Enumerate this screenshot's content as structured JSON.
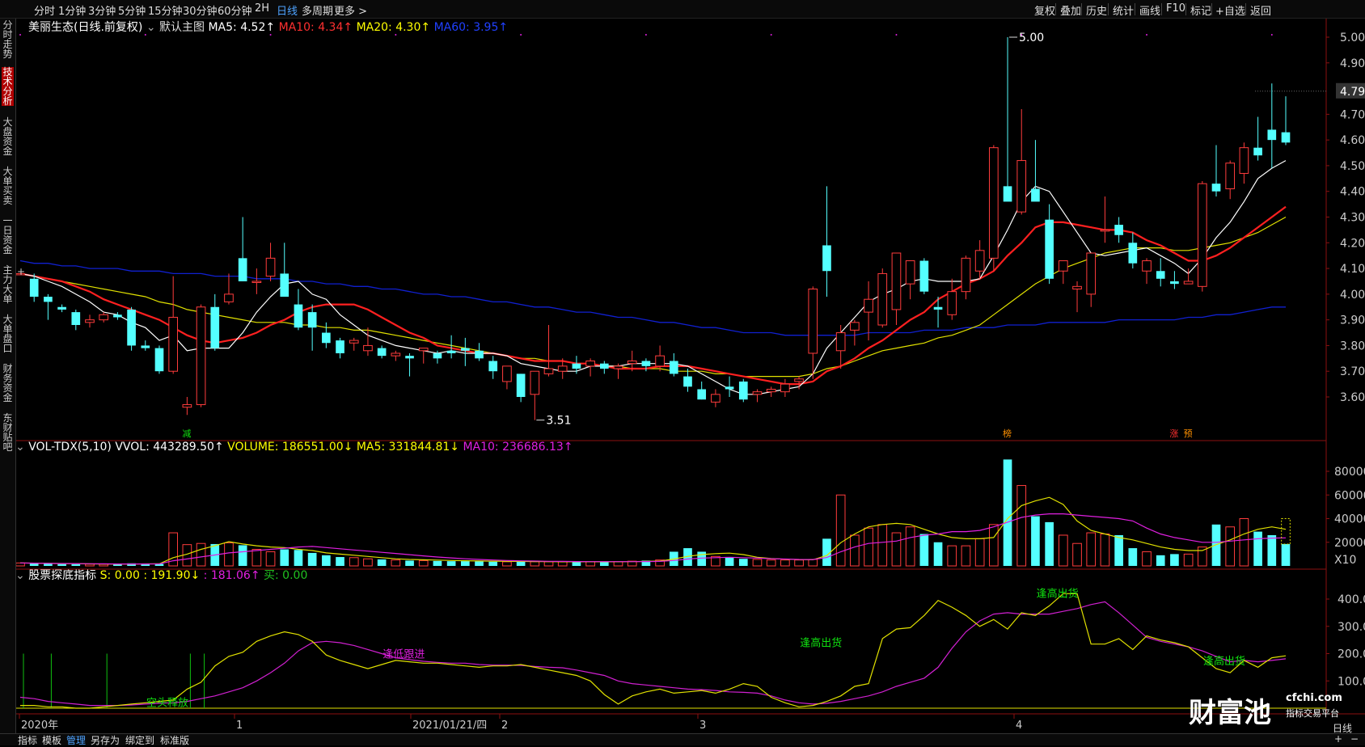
{
  "timeframes": [
    "分时",
    "1分钟",
    "3分钟",
    "5分钟",
    "15分钟",
    "30分钟",
    "60分钟",
    "2H",
    "日线",
    "多周期",
    "更多 >"
  ],
  "active_timeframe": "日线",
  "right_tools": [
    "复权",
    "叠加",
    "历史",
    "统计",
    "画线",
    "F10",
    "标记",
    "+自选",
    "返回"
  ],
  "left_tabs": [
    "分时走势",
    "技术分析",
    "大盘资金",
    "大单买卖",
    "一日资金",
    "主力大单",
    "大单盘口",
    "财务资金",
    "东财贴吧"
  ],
  "active_left_tab": "技术分析",
  "main_legend": {
    "title": "美丽生态(日线.前复权)",
    "template": "默认主图",
    "ma5": "MA5: 4.52↑",
    "ma10": "MA10: 4.34↑",
    "ma20": "MA20: 4.30↑",
    "ma60": "MA60: 3.95↑"
  },
  "vol_legend": {
    "name": "VOL-TDX(5,10)",
    "vvol": "VVOL: 443289.50↑",
    "volume": "VOLUME: 186551.00↓",
    "ma5": "MA5: 331844.81↓",
    "ma10": "MA10: 236686.13↑"
  },
  "ind_legend": {
    "name": "股票探底指标",
    "s": "S: 0.00",
    "v1": ": 191.90↓",
    "v2": ": 181.06↑",
    "buy": "买: 0.00"
  },
  "price_axis": [
    "5.00",
    "4.90",
    "4.70",
    "4.60",
    "4.50",
    "4.40",
    "4.30",
    "4.20",
    "4.10",
    "4.00",
    "3.90",
    "3.80",
    "3.70",
    "3.60"
  ],
  "current_price": "4.79",
  "vol_axis": [
    "80000",
    "60000",
    "40000",
    "20000"
  ],
  "vol_unit": "X10",
  "ind_axis": [
    "400.0",
    "300.0",
    "200.0",
    "100.0"
  ],
  "annotations": {
    "high": "5.00",
    "low": "3.51",
    "markers": [
      "减",
      "榜",
      "涨",
      "预"
    ],
    "signals": [
      "空头释放",
      "逢低跟进",
      "逢高出货",
      "逢高出货",
      "逢高出货"
    ]
  },
  "date_axis": [
    "2020年",
    "1",
    "2021/01/21/四",
    "2",
    "3",
    "4"
  ],
  "bottom_tabs": [
    "指标",
    "模板",
    "管理",
    "另存为",
    "绑定到",
    "标准版"
  ],
  "active_bottom_tab": "管理",
  "bottom_right": [
    "日线",
    "+",
    "−"
  ],
  "logo": {
    "brand": "财富池",
    "domain": "cfchi.com",
    "slogan": "指标交易平台"
  },
  "chart_data": {
    "type": "candlestick",
    "ylim": [
      3.45,
      5.05
    ],
    "candles": [
      [
        4.08,
        4.08,
        4.08,
        4.08
      ],
      [
        4.06,
        4.08,
        3.97,
        3.99
      ],
      [
        3.99,
        4.0,
        3.9,
        3.97
      ],
      [
        3.95,
        3.96,
        3.93,
        3.94
      ],
      [
        3.93,
        3.94,
        3.86,
        3.88
      ],
      [
        3.89,
        3.92,
        3.87,
        3.9
      ],
      [
        3.9,
        3.93,
        3.89,
        3.92
      ],
      [
        3.92,
        3.93,
        3.9,
        3.91
      ],
      [
        3.94,
        3.95,
        3.78,
        3.8
      ],
      [
        3.8,
        3.82,
        3.78,
        3.79
      ],
      [
        3.79,
        3.8,
        3.69,
        3.7
      ],
      [
        3.7,
        4.07,
        3.69,
        3.91
      ],
      [
        3.56,
        3.6,
        3.53,
        3.57
      ],
      [
        3.57,
        3.96,
        3.56,
        3.95
      ],
      [
        3.95,
        4.0,
        3.78,
        3.79
      ],
      [
        3.97,
        4.08,
        3.96,
        4.0
      ],
      [
        4.14,
        4.3,
        4.05,
        4.05
      ],
      [
        4.05,
        4.1,
        4.0,
        4.05
      ],
      [
        4.07,
        4.2,
        4.05,
        4.14
      ],
      [
        4.08,
        4.2,
        4.0,
        3.99
      ],
      [
        3.96,
        4.02,
        3.86,
        3.87
      ],
      [
        3.93,
        3.96,
        3.78,
        3.87
      ],
      [
        3.85,
        3.89,
        3.79,
        3.81
      ],
      [
        3.82,
        3.83,
        3.75,
        3.77
      ],
      [
        3.81,
        3.83,
        3.78,
        3.82
      ],
      [
        3.78,
        3.87,
        3.76,
        3.8
      ],
      [
        3.79,
        3.8,
        3.75,
        3.76
      ],
      [
        3.76,
        3.78,
        3.74,
        3.77
      ],
      [
        3.76,
        3.77,
        3.68,
        3.75
      ],
      [
        3.78,
        3.79,
        3.73,
        3.79
      ],
      [
        3.77,
        3.78,
        3.73,
        3.75
      ],
      [
        3.78,
        3.84,
        3.75,
        3.77
      ],
      [
        3.79,
        3.83,
        3.72,
        3.78
      ],
      [
        3.78,
        3.81,
        3.74,
        3.75
      ],
      [
        3.74,
        3.76,
        3.67,
        3.7
      ],
      [
        3.66,
        3.72,
        3.63,
        3.72
      ],
      [
        3.69,
        3.69,
        3.58,
        3.6
      ],
      [
        3.61,
        3.7,
        3.51,
        3.7
      ],
      [
        3.69,
        3.88,
        3.68,
        3.71
      ],
      [
        3.7,
        3.75,
        3.67,
        3.72
      ],
      [
        3.73,
        3.76,
        3.69,
        3.71
      ],
      [
        3.72,
        3.75,
        3.68,
        3.74
      ],
      [
        3.73,
        3.74,
        3.69,
        3.71
      ],
      [
        3.71,
        3.73,
        3.67,
        3.72
      ],
      [
        3.73,
        3.78,
        3.7,
        3.74
      ],
      [
        3.74,
        3.75,
        3.7,
        3.72
      ],
      [
        3.72,
        3.8,
        3.7,
        3.76
      ],
      [
        3.74,
        3.77,
        3.68,
        3.69
      ],
      [
        3.68,
        3.71,
        3.62,
        3.64
      ],
      [
        3.63,
        3.66,
        3.59,
        3.59
      ],
      [
        3.58,
        3.63,
        3.56,
        3.61
      ],
      [
        3.64,
        3.68,
        3.6,
        3.63
      ],
      [
        3.66,
        3.67,
        3.58,
        3.59
      ],
      [
        3.61,
        3.63,
        3.58,
        3.62
      ],
      [
        3.62,
        3.64,
        3.6,
        3.63
      ],
      [
        3.62,
        3.67,
        3.6,
        3.65
      ],
      [
        3.66,
        3.68,
        3.63,
        3.67
      ],
      [
        3.77,
        4.03,
        3.67,
        4.02
      ],
      [
        4.19,
        4.42,
        3.99,
        4.09
      ],
      [
        3.78,
        3.88,
        3.71,
        3.85
      ],
      [
        3.86,
        3.9,
        3.8,
        3.89
      ],
      [
        3.93,
        4.05,
        3.82,
        3.98
      ],
      [
        3.88,
        4.1,
        3.87,
        4.08
      ],
      [
        3.94,
        4.16,
        3.88,
        4.16
      ],
      [
        4.04,
        4.13,
        3.98,
        4.13
      ],
      [
        4.13,
        4.14,
        4.0,
        4.01
      ],
      [
        3.95,
        3.99,
        3.87,
        3.94
      ],
      [
        3.92,
        4.06,
        3.9,
        4.01
      ],
      [
        4.01,
        4.15,
        3.98,
        4.14
      ],
      [
        4.09,
        4.21,
        4.06,
        4.17
      ],
      [
        4.14,
        4.58,
        4.09,
        4.57
      ],
      [
        4.42,
        5.0,
        4.37,
        4.36
      ],
      [
        4.32,
        4.72,
        4.31,
        4.52
      ],
      [
        4.41,
        4.6,
        4.38,
        4.36
      ],
      [
        4.29,
        4.35,
        4.04,
        4.06
      ],
      [
        4.09,
        4.13,
        4.04,
        4.13
      ],
      [
        4.02,
        4.05,
        3.93,
        4.03
      ],
      [
        4.0,
        4.15,
        3.95,
        4.16
      ],
      [
        4.25,
        4.38,
        4.2,
        4.25
      ],
      [
        4.27,
        4.3,
        4.2,
        4.23
      ],
      [
        4.2,
        4.24,
        4.1,
        4.12
      ],
      [
        4.09,
        4.14,
        4.04,
        4.13
      ],
      [
        4.09,
        4.14,
        4.03,
        4.06
      ],
      [
        4.05,
        4.09,
        4.02,
        4.04
      ],
      [
        4.04,
        4.1,
        4.04,
        4.05
      ],
      [
        4.03,
        4.44,
        4.01,
        4.43
      ],
      [
        4.43,
        4.58,
        4.38,
        4.4
      ],
      [
        4.41,
        4.52,
        4.37,
        4.51
      ],
      [
        4.47,
        4.59,
        4.43,
        4.57
      ],
      [
        4.57,
        4.69,
        4.52,
        4.54
      ],
      [
        4.64,
        4.82,
        4.49,
        4.6
      ],
      [
        4.63,
        4.77,
        4.58,
        4.59
      ]
    ],
    "ma5": [
      4.08,
      4.07,
      4.05,
      4.03,
      4.0,
      3.97,
      3.93,
      3.92,
      3.89,
      3.87,
      3.82,
      3.84,
      3.78,
      3.79,
      3.79,
      3.79,
      3.85,
      3.93,
      3.99,
      4.04,
      4.05,
      4.0,
      3.98,
      3.92,
      3.88,
      3.84,
      3.82,
      3.8,
      3.79,
      3.78,
      3.77,
      3.78,
      3.77,
      3.77,
      3.77,
      3.76,
      3.73,
      3.72,
      3.71,
      3.7,
      3.7,
      3.72,
      3.72,
      3.72,
      3.73,
      3.73,
      3.73,
      3.73,
      3.72,
      3.69,
      3.66,
      3.63,
      3.61,
      3.61,
      3.62,
      3.63,
      3.64,
      3.69,
      3.79,
      3.85,
      3.91,
      3.97,
      4.0,
      4.02,
      4.05,
      4.06,
      4.05,
      4.05,
      4.05,
      4.06,
      4.15,
      4.25,
      4.36,
      4.42,
      4.4,
      4.32,
      4.24,
      4.16,
      4.15,
      4.16,
      4.17,
      4.18,
      4.15,
      4.12,
      4.08,
      4.14,
      4.22,
      4.28,
      4.36,
      4.45,
      4.49,
      4.52
    ],
    "ma10": [
      4.08,
      4.07,
      4.06,
      4.05,
      4.03,
      4.01,
      3.98,
      3.96,
      3.94,
      3.92,
      3.9,
      3.87,
      3.84,
      3.82,
      3.81,
      3.82,
      3.83,
      3.85,
      3.88,
      3.9,
      3.93,
      3.95,
      3.96,
      3.96,
      3.96,
      3.94,
      3.91,
      3.88,
      3.85,
      3.83,
      3.8,
      3.79,
      3.78,
      3.77,
      3.77,
      3.76,
      3.75,
      3.74,
      3.74,
      3.74,
      3.73,
      3.73,
      3.72,
      3.71,
      3.71,
      3.71,
      3.72,
      3.72,
      3.72,
      3.71,
      3.7,
      3.69,
      3.68,
      3.67,
      3.66,
      3.65,
      3.65,
      3.66,
      3.7,
      3.72,
      3.75,
      3.79,
      3.82,
      3.86,
      3.9,
      3.93,
      3.98,
      4.01,
      4.04,
      4.06,
      4.09,
      4.15,
      4.2,
      4.26,
      4.28,
      4.28,
      4.27,
      4.26,
      4.25,
      4.25,
      4.24,
      4.21,
      4.19,
      4.16,
      4.13,
      4.13,
      4.15,
      4.18,
      4.22,
      4.26,
      4.3,
      4.34
    ],
    "ma20": [
      4.08,
      4.07,
      4.06,
      4.05,
      4.04,
      4.03,
      4.02,
      4.01,
      4.0,
      3.99,
      3.97,
      3.96,
      3.94,
      3.93,
      3.92,
      3.91,
      3.9,
      3.89,
      3.89,
      3.89,
      3.88,
      3.88,
      3.87,
      3.87,
      3.86,
      3.86,
      3.85,
      3.84,
      3.83,
      3.82,
      3.81,
      3.8,
      3.79,
      3.78,
      3.77,
      3.76,
      3.75,
      3.75,
      3.74,
      3.74,
      3.73,
      3.73,
      3.72,
      3.72,
      3.71,
      3.71,
      3.71,
      3.7,
      3.7,
      3.7,
      3.69,
      3.69,
      3.68,
      3.68,
      3.68,
      3.68,
      3.68,
      3.69,
      3.71,
      3.72,
      3.74,
      3.76,
      3.78,
      3.79,
      3.8,
      3.81,
      3.83,
      3.84,
      3.86,
      3.88,
      3.92,
      3.96,
      4.0,
      4.04,
      4.07,
      4.1,
      4.12,
      4.14,
      4.16,
      4.17,
      4.18,
      4.18,
      4.18,
      4.17,
      4.17,
      4.18,
      4.19,
      4.2,
      4.22,
      4.24,
      4.27,
      4.3
    ],
    "ma60": [
      4.13,
      4.12,
      4.12,
      4.11,
      4.11,
      4.1,
      4.1,
      4.1,
      4.09,
      4.09,
      4.09,
      4.08,
      4.08,
      4.08,
      4.07,
      4.07,
      4.07,
      4.06,
      4.06,
      4.06,
      4.05,
      4.05,
      4.04,
      4.04,
      4.03,
      4.03,
      4.02,
      4.02,
      4.01,
      4.0,
      4.0,
      3.99,
      3.99,
      3.98,
      3.97,
      3.97,
      3.96,
      3.95,
      3.95,
      3.94,
      3.93,
      3.93,
      3.92,
      3.91,
      3.91,
      3.9,
      3.89,
      3.89,
      3.88,
      3.87,
      3.87,
      3.86,
      3.85,
      3.85,
      3.85,
      3.84,
      3.84,
      3.84,
      3.84,
      3.84,
      3.84,
      3.85,
      3.85,
      3.85,
      3.85,
      3.86,
      3.86,
      3.86,
      3.87,
      3.87,
      3.87,
      3.88,
      3.88,
      3.88,
      3.89,
      3.89,
      3.89,
      3.89,
      3.89,
      3.9,
      3.9,
      3.9,
      3.9,
      3.9,
      3.91,
      3.91,
      3.92,
      3.92,
      3.93,
      3.94,
      3.95,
      3.95
    ],
    "volume": [
      2500,
      2000,
      1800,
      1600,
      1500,
      1500,
      1400,
      1400,
      2200,
      1800,
      1700,
      28000,
      18000,
      19000,
      18500,
      19500,
      17500,
      14000,
      12000,
      14000,
      13500,
      11000,
      9000,
      7500,
      7000,
      6000,
      5500,
      5000,
      4500,
      4500,
      4200,
      4000,
      4000,
      3800,
      3600,
      3500,
      3500,
      3600,
      3500,
      3400,
      3500,
      3500,
      3400,
      3600,
      4000,
      4500,
      5000,
      12000,
      15000,
      12000,
      8000,
      7000,
      6000,
      5500,
      5000,
      5000,
      5000,
      5500,
      23000,
      60000,
      26000,
      32000,
      35000,
      28000,
      33000,
      27000,
      20000,
      17000,
      17000,
      23000,
      35000,
      90000,
      68000,
      42000,
      37000,
      26000,
      19000,
      28000,
      27000,
      26000,
      15000,
      12000,
      9000,
      10000,
      10000,
      16000,
      35000,
      33000,
      40000,
      29000,
      26000,
      18500
    ],
    "vol_ma5": [
      2500,
      2300,
      2100,
      2000,
      1900,
      1700,
      1600,
      1500,
      1600,
      1700,
      1800,
      7000,
      10000,
      14000,
      17000,
      20500,
      18500,
      17000,
      16000,
      15500,
      14000,
      13000,
      11000,
      10000,
      9000,
      8000,
      7000,
      6000,
      5500,
      5200,
      4900,
      4600,
      4400,
      4200,
      4000,
      3900,
      3800,
      3700,
      3600,
      3500,
      3500,
      3500,
      3500,
      3500,
      3600,
      3800,
      4100,
      5800,
      8100,
      9600,
      10400,
      10800,
      9600,
      7300,
      6300,
      5700,
      5300,
      5200,
      8800,
      19600,
      27000,
      33000,
      35000,
      36000,
      35000,
      31000,
      27000,
      24000,
      23000,
      23000,
      24000,
      40000,
      51000,
      55000,
      58000,
      52000,
      38000,
      30000,
      27000,
      24000,
      22000,
      19000,
      16000,
      14000,
      13000,
      13000,
      18000,
      22000,
      27000,
      31000,
      33000,
      31000
    ],
    "vol_ma10": [
      2500,
      2300,
      2150,
      2050,
      1950,
      1850,
      1750,
      1650,
      1650,
      1650,
      1700,
      4400,
      5900,
      7600,
      9200,
      11000,
      12000,
      13000,
      14000,
      15000,
      16000,
      16500,
      15500,
      14500,
      13500,
      12500,
      11500,
      10500,
      9500,
      8500,
      7500,
      6800,
      6000,
      5500,
      5000,
      4600,
      4300,
      4100,
      3900,
      3800,
      3700,
      3600,
      3600,
      3600,
      3600,
      3700,
      3800,
      4600,
      5800,
      6600,
      7000,
      7300,
      7000,
      6600,
      6100,
      5800,
      5500,
      5400,
      7100,
      12000,
      16000,
      19000,
      20000,
      21000,
      24000,
      26000,
      27000,
      29000,
      29000,
      30000,
      33000,
      37000,
      41000,
      43000,
      44000,
      44000,
      43000,
      42000,
      41000,
      40000,
      38000,
      32000,
      27000,
      24000,
      22000,
      20000,
      20000,
      21000,
      22000,
      23000,
      23500,
      23700
    ],
    "ind1": [
      10,
      10,
      5,
      5,
      0,
      0,
      5,
      10,
      15,
      20,
      25,
      30,
      70,
      95,
      155,
      190,
      205,
      245,
      265,
      280,
      270,
      245,
      195,
      175,
      160,
      145,
      160,
      175,
      170,
      165,
      165,
      160,
      155,
      150,
      155,
      155,
      160,
      150,
      140,
      130,
      120,
      100,
      50,
      15,
      45,
      60,
      70,
      55,
      60,
      65,
      55,
      70,
      90,
      80,
      40,
      20,
      5,
      10,
      25,
      45,
      80,
      90,
      255,
      290,
      295,
      340,
      395,
      370,
      340,
      300,
      325,
      290,
      350,
      340,
      375,
      420,
      420,
      235,
      235,
      255,
      215,
      265,
      250,
      240,
      225,
      185,
      145,
      130,
      175,
      150,
      185,
      191.9
    ],
    "ind2": [
      40,
      35,
      25,
      20,
      15,
      10,
      10,
      10,
      12,
      15,
      18,
      20,
      25,
      35,
      45,
      60,
      75,
      100,
      130,
      165,
      210,
      240,
      245,
      240,
      230,
      215,
      200,
      185,
      178,
      172,
      168,
      165,
      165,
      160,
      158,
      158,
      157,
      153,
      150,
      148,
      140,
      130,
      120,
      100,
      90,
      85,
      80,
      75,
      70,
      68,
      65,
      60,
      58,
      55,
      45,
      30,
      20,
      15,
      18,
      25,
      35,
      45,
      60,
      80,
      95,
      110,
      150,
      220,
      280,
      320,
      345,
      350,
      345,
      345,
      345,
      355,
      365,
      380,
      390,
      350,
      305,
      260,
      245,
      235,
      225,
      210,
      190,
      170,
      175,
      170,
      175,
      181.06
    ]
  }
}
